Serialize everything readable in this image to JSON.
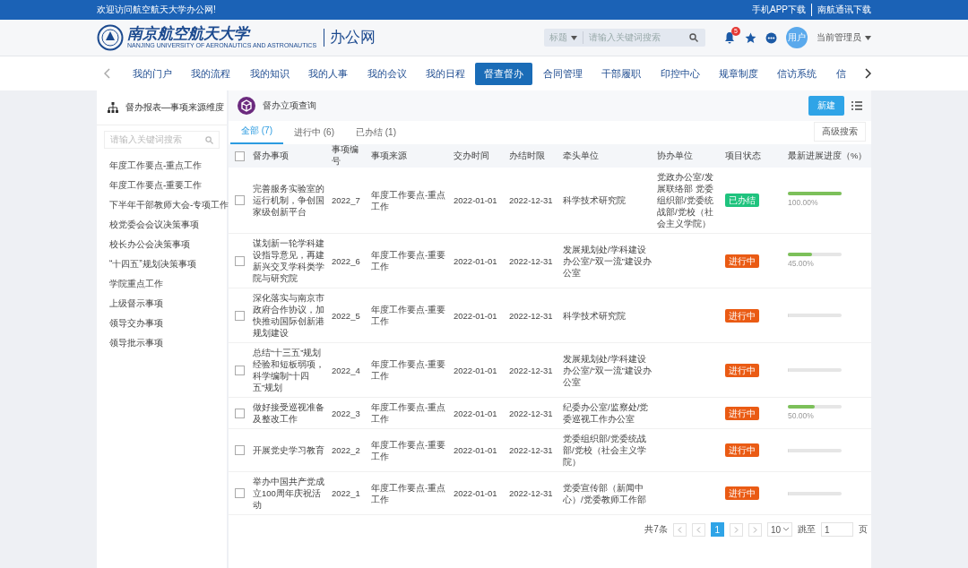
{
  "topbar": {
    "welcome": "欢迎访问航空航天大学办公网!",
    "links": [
      "手机APP下载",
      "南航通讯下载"
    ]
  },
  "header": {
    "logo_name": "南京航空航天大学",
    "logo_english": "NANJING UNIVERSITY OF AERONAUTICS AND ASTRONAUTICS",
    "site_name": "办公网",
    "search": {
      "scope": "标题",
      "placeholder": "请输入关键词搜索"
    },
    "notifications_badge": "5",
    "avatar_text": "用户",
    "user_name": "当前管理员"
  },
  "nav": {
    "tabs": [
      {
        "label": "我的门户",
        "selected": false
      },
      {
        "label": "我的流程",
        "selected": false
      },
      {
        "label": "我的知识",
        "selected": false
      },
      {
        "label": "我的人事",
        "selected": false
      },
      {
        "label": "我的会议",
        "selected": false
      },
      {
        "label": "我的日程",
        "selected": false
      },
      {
        "label": "督查督办",
        "selected": true
      },
      {
        "label": "合同管理",
        "selected": false
      },
      {
        "label": "干部履职",
        "selected": false
      },
      {
        "label": "印控中心",
        "selected": false
      },
      {
        "label": "规章制度",
        "selected": false
      },
      {
        "label": "信访系统",
        "selected": false
      },
      {
        "label": "信",
        "selected": false
      }
    ]
  },
  "sidebar": {
    "title": "督办报表—事项来源维度",
    "search": {
      "placeholder": "请输入关键词搜索"
    },
    "items": [
      "年度工作要点-重点工作",
      "年度工作要点-重要工作",
      "下半年干部教师大会-专项工作",
      "校党委会会议决策事项",
      "校长办公会决策事项",
      "“十四五”规划决策事项",
      "学院重点工作",
      "上级督示事项",
      "领导交办事项",
      "领导批示事项"
    ]
  },
  "main": {
    "title": "督办立项查询",
    "new_button": "新建",
    "advanced_search": "高级搜索",
    "tabs": [
      {
        "label": "全部 (7)",
        "selected": true
      },
      {
        "label": "进行中 (6)",
        "selected": false
      },
      {
        "label": "已办结 (1)",
        "selected": false
      }
    ],
    "table": {
      "select_all": {
        "checked": false
      },
      "columns": [
        "督办事项",
        "事项编号",
        "事项来源",
        "交办时间",
        "办结时限",
        "牵头单位",
        "协办单位",
        "项目状态",
        "最新进展进度（%）"
      ],
      "rows": [
        {
          "checked": false,
          "item": "完善服务实验室的运行机制，争创国家级创新平台",
          "number": "2022_7",
          "source": "年度工作要点-重点工作",
          "assigned": "2022-01-01",
          "deadline": "2022-12-31",
          "lead": "科学技术研究院",
          "assist": "党政办公室/发展联络部 党委组织部/党委统战部/党校（社会主义学院）",
          "status": {
            "label": "已办结",
            "kind": "done"
          },
          "level": 1,
          "reading": "100.00%"
        },
        {
          "checked": false,
          "item": "谋划新一轮学科建设指导意见，再建新兴交叉学科类学院与研究院",
          "number": "2022_6",
          "source": "年度工作要点-重要工作",
          "assigned": "2022-01-01",
          "deadline": "2022-12-31",
          "lead": "发展规划处/学科建设办公室/“双一流”建设办公室",
          "status": {
            "label": "进行中",
            "kind": "ongoing"
          },
          "level": 0.45,
          "reading": "45.00%"
        },
        {
          "checked": false,
          "item": "深化落实与南京市政府合作协议，加快推动国际创新港规划建设",
          "number": "2022_5",
          "source": "年度工作要点-重要工作",
          "assigned": "2022-01-01",
          "deadline": "2022-12-31",
          "lead": "科学技术研究院",
          "status": {
            "label": "进行中",
            "kind": "ongoing"
          },
          "level": 0
        },
        {
          "checked": false,
          "item": "总结“十三五”规划经验和短板弱项，科学编制“十四五”规划",
          "number": "2022_4",
          "source": "年度工作要点-重要工作",
          "assigned": "2022-01-01",
          "deadline": "2022-12-31",
          "lead": "发展规划处/学科建设办公室/“双一流”建设办公室",
          "status": {
            "label": "进行中",
            "kind": "ongoing"
          },
          "level": 0
        },
        {
          "checked": false,
          "item": "做好接受巡视准备及整改工作",
          "number": "2022_3",
          "source": "年度工作要点-重点工作",
          "assigned": "2022-01-01",
          "deadline": "2022-12-31",
          "lead": "纪委办公室/监察处/党委巡视工作办公室",
          "status": {
            "label": "进行中",
            "kind": "ongoing"
          },
          "level": 0.5,
          "reading": "50.00%"
        },
        {
          "checked": false,
          "item": "开展党史学习教育",
          "number": "2022_2",
          "source": "年度工作要点-重要工作",
          "assigned": "2022-01-01",
          "deadline": "2022-12-31",
          "lead": "党委组织部/党委统战部/党校（社会主义学院）",
          "status": {
            "label": "进行中",
            "kind": "ongoing"
          },
          "level": 0
        },
        {
          "checked": false,
          "item": "举办中国共产党成立100周年庆祝活动",
          "number": "2022_1",
          "source": "年度工作要点-重点工作",
          "assigned": "2022-01-01",
          "deadline": "2022-12-31",
          "lead": "党委宣传部（新闻中心）/党委教师工作部",
          "status": {
            "label": "进行中",
            "kind": "ongoing"
          },
          "level": 0
        }
      ]
    },
    "pagination": {
      "total": "共7条",
      "pages": [
        {
          "label": "1",
          "selected": true
        }
      ],
      "page_size": "10",
      "goto_label": "跳至",
      "goto_value": "1",
      "page_unit": "页"
    }
  }
}
